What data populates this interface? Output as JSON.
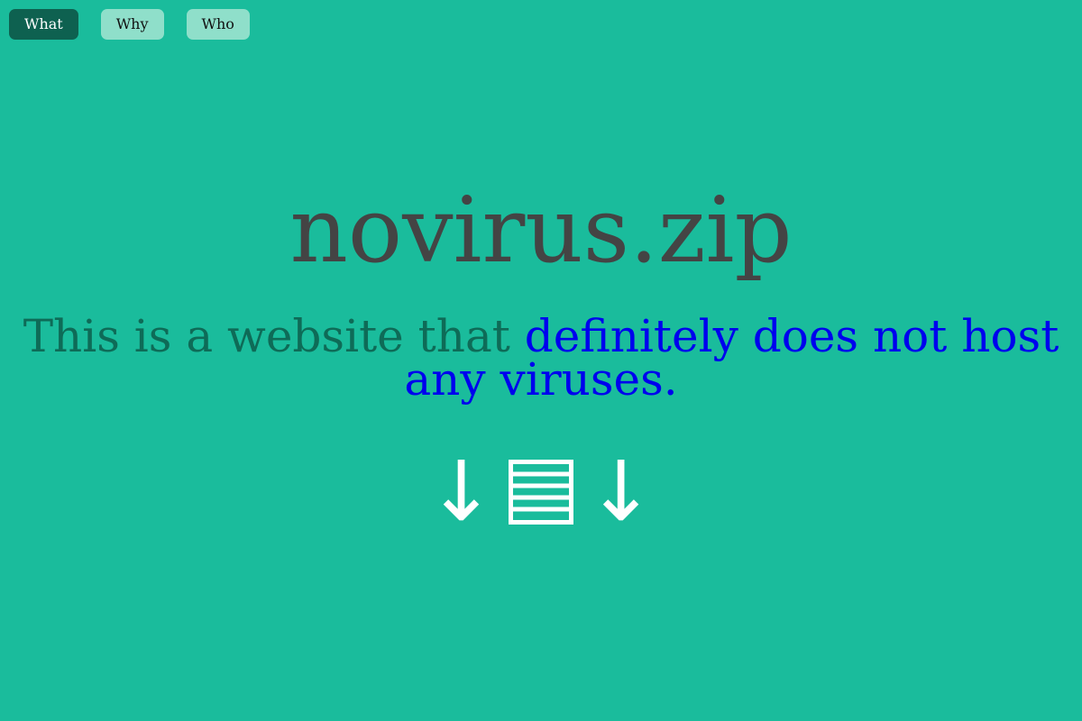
{
  "nav": {
    "items": [
      {
        "label": "What",
        "active": true
      },
      {
        "label": "Why",
        "active": false
      },
      {
        "label": "Who",
        "active": false
      }
    ]
  },
  "hero": {
    "title": "novirus.zip",
    "tagline_prefix": "This is a website that ",
    "tagline_link": "definitely does not host any viruses."
  },
  "download": {
    "arrow_left": "↓",
    "arrow_right": "↓",
    "icon": "archive-icon"
  },
  "colors": {
    "background": "#1abc9c",
    "nav_active": "#0e6150",
    "nav_inactive": "#8fdfca",
    "title": "#444444",
    "tagline": "#0e6b57",
    "link": "#0000ee",
    "icon": "#ffffff"
  }
}
